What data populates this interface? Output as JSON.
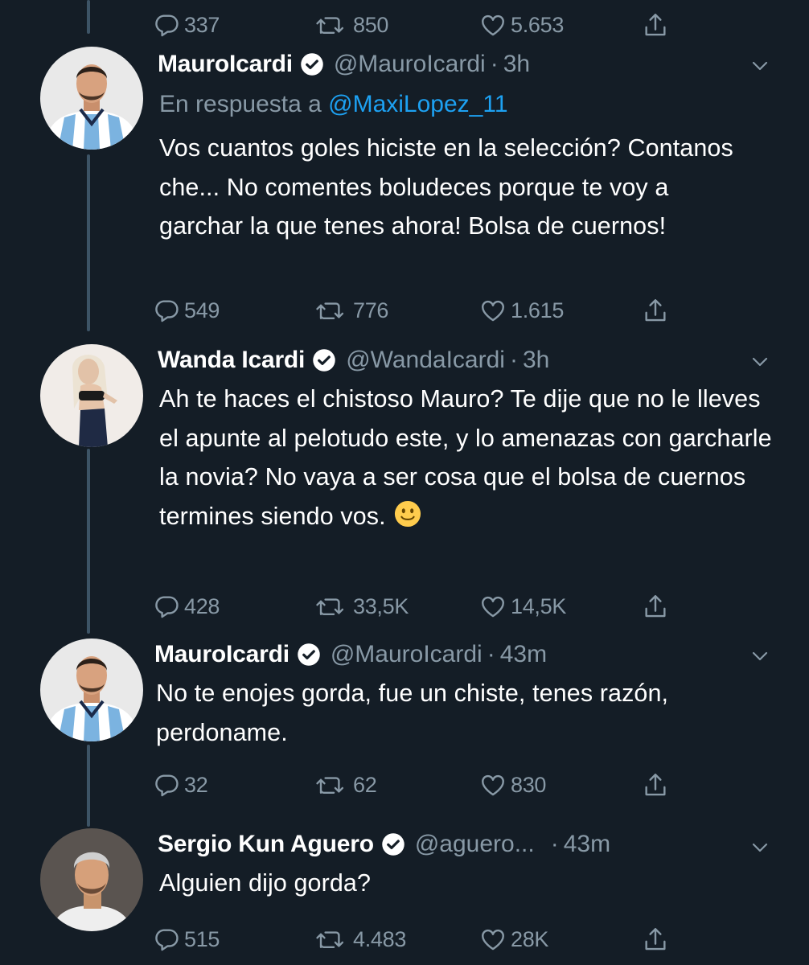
{
  "colors": {
    "background": "#141d26",
    "text": "#ffffff",
    "secondary": "#8899a6",
    "link": "#1da1f2",
    "thread_line": "#3d5466"
  },
  "top_actions": {
    "replies": "337",
    "retweets": "850",
    "likes": "5.653"
  },
  "tweets": [
    {
      "name": "MauroIcardi",
      "handle": "@MauroIcardi",
      "separator": "·",
      "time": "3h",
      "reply_to_label": "En respuesta a",
      "reply_to_mention": "@MaxiLopez_11",
      "text": "Vos cuantos goles hiciste en la selección? Contanos che... No comentes boludeces porque te voy a garchar la que tenes ahora! Bolsa de cuernos!",
      "replies": "549",
      "retweets": "776",
      "likes": "1.615"
    },
    {
      "name": "Wanda Icardi",
      "handle": "@WandaIcardi",
      "separator": "·",
      "time": "3h",
      "text": "Ah te haces el chistoso Mauro? Te dije que no le lleves el apunte al pelotudo este, y lo amenazas con garcharle la novia? No vaya a ser cosa que el bolsa de cuernos termines siendo vos.",
      "emoji": "slightly-smiling-face-icon",
      "replies": "428",
      "retweets": "33,5K",
      "likes": "14,5K"
    },
    {
      "name": "MauroIcardi",
      "handle": "@MauroIcardi",
      "separator": "·",
      "time": "43m",
      "text": "No te enojes gorda, fue un chiste, tenes razón, perdoname.",
      "replies": "32",
      "retweets": "62",
      "likes": "830"
    },
    {
      "name": "Sergio Kun Aguero",
      "handle": "@aguero...",
      "separator": "·",
      "time": "43m",
      "text": "Alguien dijo gorda?",
      "replies": "515",
      "retweets": "4.483",
      "likes": "28K"
    }
  ],
  "icons": {
    "reply": "reply-icon",
    "retweet": "retweet-icon",
    "like": "heart-icon",
    "share": "share-icon",
    "verified": "verified-badge-icon",
    "more": "chevron-down-icon"
  }
}
